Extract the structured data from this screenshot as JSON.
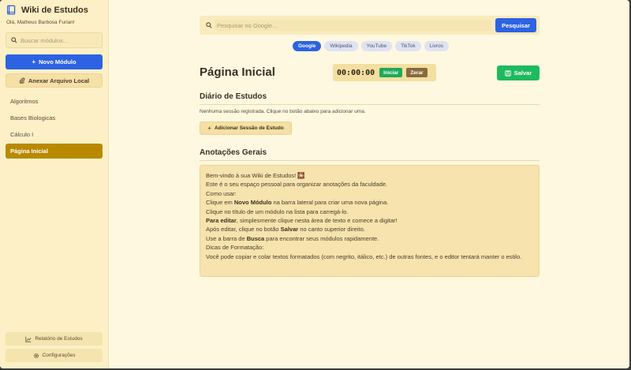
{
  "sidebar": {
    "title": "Wiki de Estudos",
    "greeting": "Olá, Matheus Barbosa Furian!",
    "search_placeholder": "Buscar módulos...",
    "new_module": "Novo Módulo",
    "attach": "Anexar Arquivo Local",
    "items": [
      {
        "label": "Algoritmos"
      },
      {
        "label": "Bases Biologicas"
      },
      {
        "label": "Cálculo I"
      },
      {
        "label": "Página Inicial",
        "active": true
      }
    ],
    "report": "Relatório de Estudos",
    "settings": "Configurações"
  },
  "search": {
    "placeholder": "Pesquisar no Google...",
    "button": "Pesquisar",
    "engines": [
      {
        "label": "Google",
        "active": true
      },
      {
        "label": "Wikipedia"
      },
      {
        "label": "YouTube"
      },
      {
        "label": "TikTok"
      },
      {
        "label": "Livros"
      }
    ]
  },
  "main": {
    "title": "Página Inicial",
    "timer": {
      "value": "00:00:00",
      "start": "Iniciar",
      "reset": "Zerar"
    },
    "save": "Salvar",
    "diary": {
      "title": "Diário de Estudos",
      "empty": "Nenhuma sessão registrada. Clique no botão abaixo para adicionar uma.",
      "add": "Adicionar Sessão de Estudo"
    },
    "notes": {
      "title": "Anotações Gerais",
      "welcome": "Bem-vindo à sua Wiki de Estudos! 🎇",
      "intro": "Este é o seu espaço pessoal para organizar anotações da faculdade.",
      "how_to": "Como usar:",
      "l1_pre": "Clique em ",
      "l1_bold": "Novo Módulo",
      "l1_post": " na barra lateral para criar uma nova página.",
      "l2": "Clique no título de um módulo na lista para carregá-lo.",
      "l3_bold": "Para editar",
      "l3_post": ", simplesmente clique nesta área de texto e comece a digitar!",
      "l4_pre": "Após editar, clique no botão ",
      "l4_bold": "Salvar",
      "l4_post": " no canto superior direito.",
      "l5_pre": "Use a barra de ",
      "l5_bold": "Busca",
      "l5_post": " para encontrar seus módulos rapidamente.",
      "tips": "Dicas de Formatação:",
      "l6": "Você pode copiar e colar textos formatados (com negrito, itálico, etc.) de outras fontes, e o editor tentará manter o estilo."
    }
  }
}
